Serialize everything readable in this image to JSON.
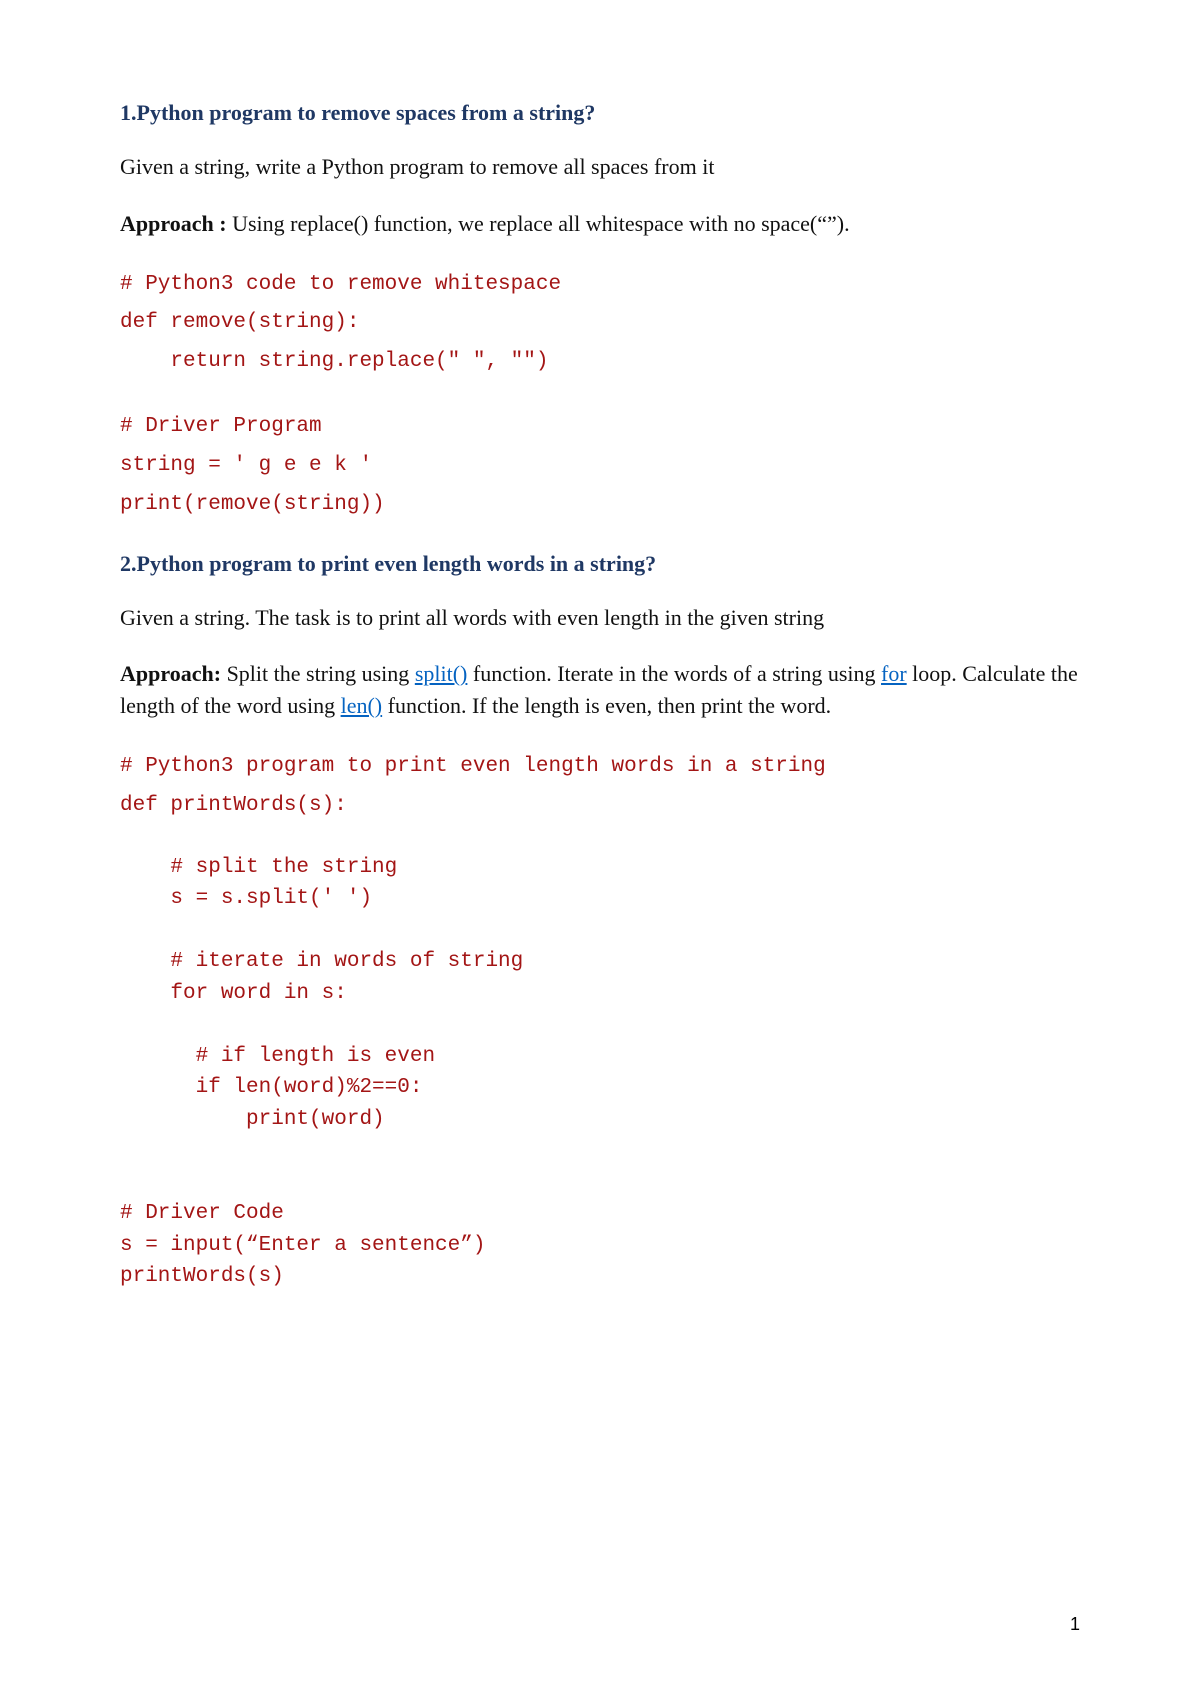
{
  "q1": {
    "heading": "1.Python program to remove spaces from a string?",
    "intro": "Given a string, write a Python program to remove all spaces from it",
    "approach_label": "Approach :",
    "approach_text": " Using replace() function, we replace all whitespace with no space(“”).",
    "code_a": "# Python3 code to remove whitespace\ndef remove(string):\n    return string.replace(\" \", \"\")\n",
    "code_b": "# Driver Program\nstring = ' g e e k '\nprint(remove(string))"
  },
  "q2": {
    "heading": "2.Python program to print even length words in a string?",
    "intro": "Given a string. The task is to print all words with even length in the given string",
    "approach_label": "Approach:",
    "approach_a": " Split the string using ",
    "link_split": "split()",
    "approach_b": " function. Iterate in the words of a string using ",
    "link_for": "for",
    "approach_c": " loop. Calculate the length of the word using ",
    "link_len": "len()",
    "approach_d": " function. If the length is even, then print the word.",
    "code_a": "# Python3 program to print even length words in a string\ndef printWords(s):",
    "code_b": "    # split the string\n    s = s.split(' ')\n\n    # iterate in words of string\n    for word in s:\n\n      # if length is even\n      if len(word)%2==0:\n          print(word)\n\n\n# Driver Code\ns = input(“Enter a sentence”)\nprintWords(s)"
  },
  "page_number": "1"
}
